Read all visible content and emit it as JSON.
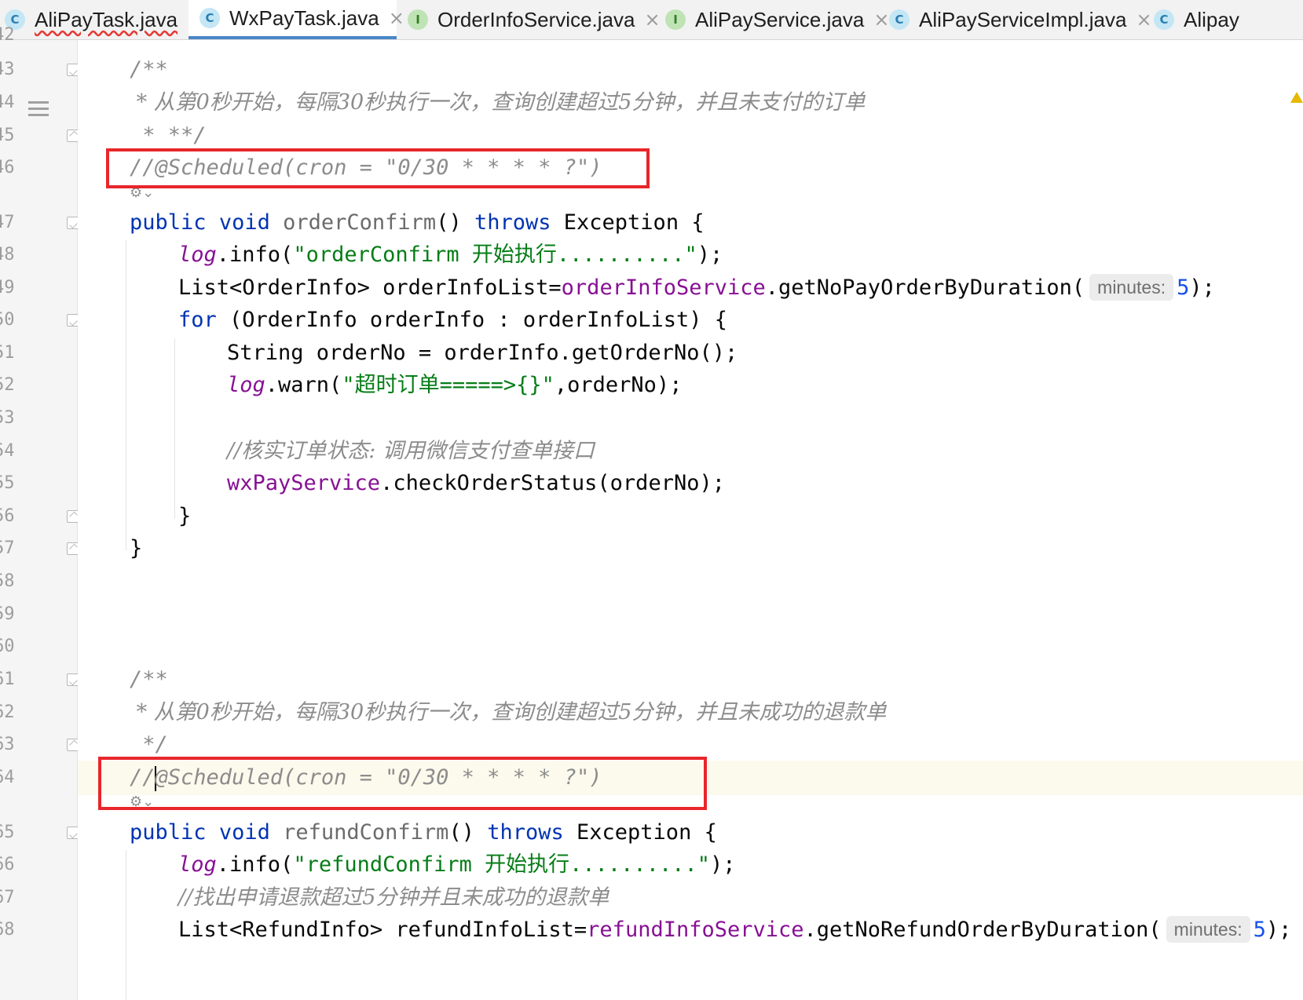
{
  "tabs": [
    {
      "label": "AliPayTask.java",
      "kind": "C",
      "icon": "class-icon",
      "active": false,
      "error": true,
      "closable": true
    },
    {
      "label": "WxPayTask.java",
      "kind": "C",
      "icon": "class-icon",
      "active": true,
      "error": false,
      "closable": true
    },
    {
      "label": "OrderInfoService.java",
      "kind": "I",
      "icon": "interface-icon",
      "active": false,
      "error": false,
      "closable": true
    },
    {
      "label": "AliPayService.java",
      "kind": "I",
      "icon": "interface-icon",
      "active": false,
      "error": false,
      "closable": true
    },
    {
      "label": "AliPayServiceImpl.java",
      "kind": "C",
      "icon": "class-icon",
      "active": false,
      "error": false,
      "closable": true
    },
    {
      "label": "Alipay",
      "kind": "C",
      "icon": "class-icon",
      "active": false,
      "error": false,
      "closable": false
    }
  ],
  "close_glyph": "×",
  "line_numbers": [
    "42",
    "43",
    "44",
    "45",
    "46",
    "47",
    "48",
    "49",
    "50",
    "51",
    "52",
    "53",
    "54",
    "55",
    "56",
    "57",
    "58",
    "59",
    "60",
    "61",
    "62",
    "63",
    "64",
    "65",
    "66",
    "67",
    "68"
  ],
  "code": {
    "c43": "/**",
    "c44": " * 从第0秒开始，每隔30秒执行一次，查询创建超过5分钟，并且未支付的订单",
    "c45": " * **/",
    "c46": "//@Scheduled(cron = \"0/30 * * * * ?\")",
    "kw_public": "public",
    "kw_void": "void",
    "m1_name": "orderConfirm",
    "m1_params": "() ",
    "kw_throws": "throws",
    "m1_exc": " Exception {",
    "log": "log",
    "info": ".info(",
    "s48": "\"orderConfirm 开始执行..........\"",
    "end_stmt": ");",
    "l49_a": "List<OrderInfo> orderInfoList=",
    "l49_field": "orderInfoService",
    "l49_b": ".getNoPayOrderByDuration(",
    "hint_label": "minutes:",
    "hint_value": "5",
    "kw_for": "for",
    "l50_rest": " (OrderInfo orderInfo : orderInfoList) {",
    "l51": "String orderNo = orderInfo.getOrderNo();",
    "warn": ".warn(",
    "s52": "\"超时订单=====>{}\"",
    "l52_end": ",orderNo);",
    "c54": "//核实订单状态: 调用微信支付查单接口",
    "l55_field": "wxPayService",
    "l55_rest": ".checkOrderStatus(orderNo);",
    "brace": "}",
    "c61": "/**",
    "c62": " * 从第0秒开始，每隔30秒执行一次，查询创建超过5分钟，并且未成功的退款单",
    "c63": " */",
    "c64_a": "//",
    "c64_b": "@Scheduled(cron = \"0/30 * * * * ?\")",
    "m2_name": "refundConfirm",
    "s66": "\"refundConfirm 开始执行..........\"",
    "c67": "//找出申请退款超过5分钟并且未成功的退款单",
    "l68_a": "List<RefundInfo> refundInfoList=",
    "l68_field": "refundInfoService",
    "l68_b": ".getNoRefundOrderByDuration(",
    "l68_hint_value": "5",
    "l68_end": ");"
  },
  "colors": {
    "keyword": "#0033b3",
    "string": "#067d17",
    "field": "#871094",
    "comment": "#8c8c8c",
    "number": "#1750eb",
    "highlight_box": "#e8262b",
    "active_tab_underline": "#4a86c8"
  }
}
